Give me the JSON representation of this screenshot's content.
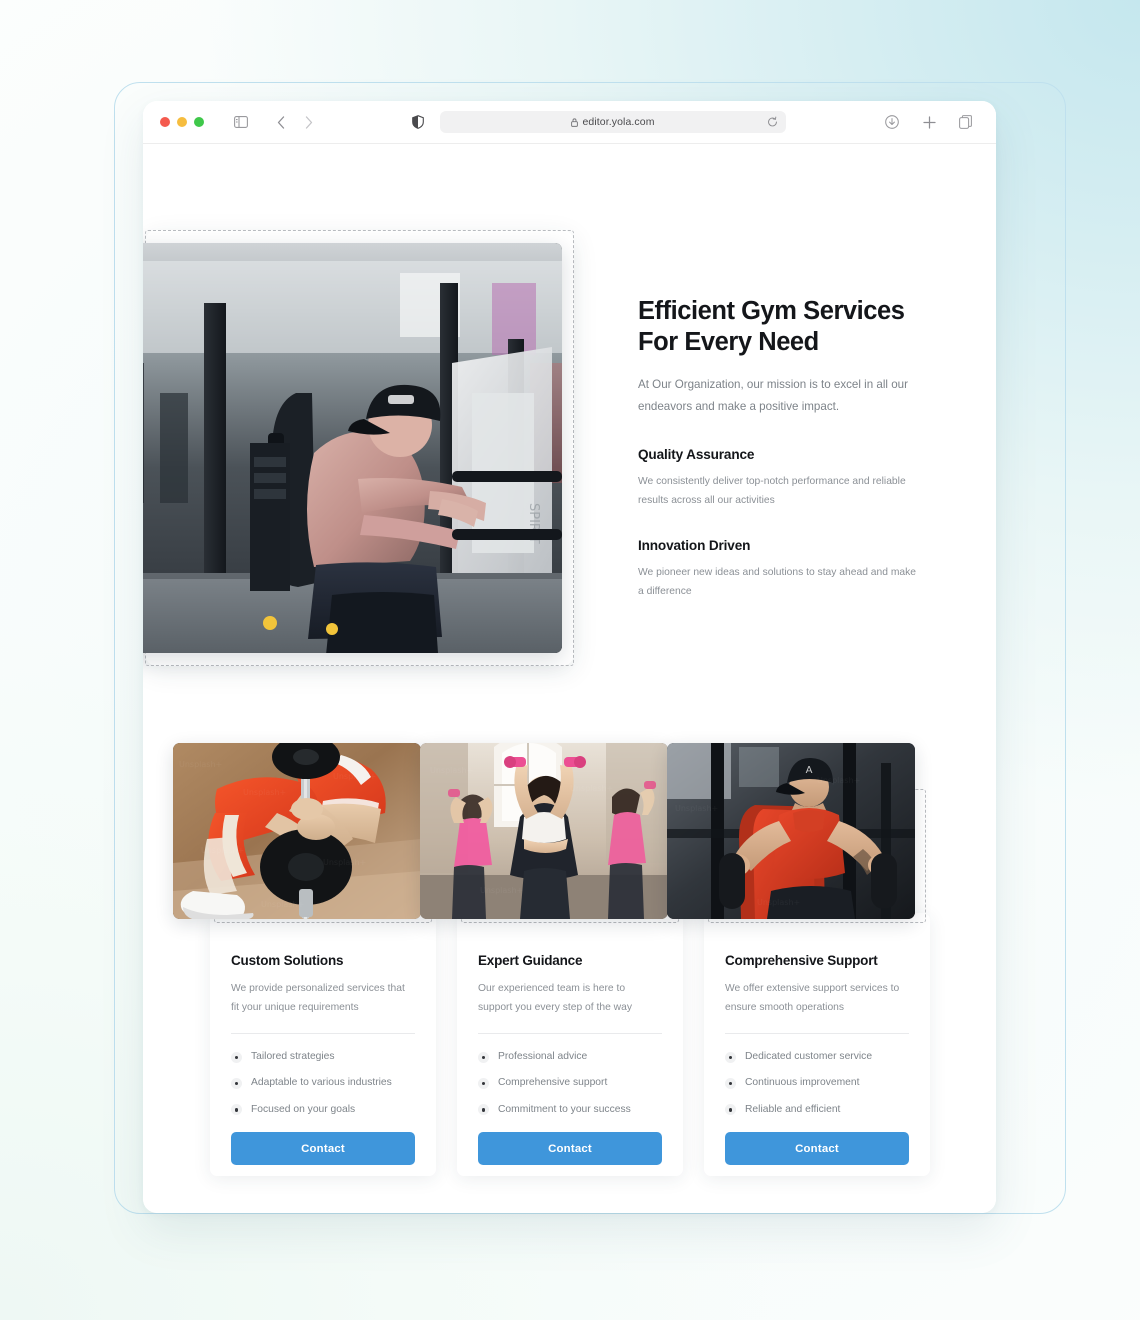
{
  "browser": {
    "traffic_lights": [
      "close",
      "minimize",
      "maximize"
    ],
    "url": "editor.yola.com",
    "lock_icon": "lock-icon",
    "sidebar_icon": "sidebar-toggle-icon",
    "back_icon": "chevron-left-icon",
    "forward_icon": "chevron-right-icon",
    "shield_icon": "shield-icon",
    "reload_icon": "reload-icon",
    "download_icon": "download-icon",
    "new_tab_icon": "plus-icon",
    "tab_overview_icon": "tab-overview-icon"
  },
  "hero": {
    "image_alt": "man-training-on-gym-cable-machine",
    "title": "Efficient Gym Services For Every Need",
    "subtitle": "At Our Organization, our mission is to excel in all our endeavors and make a positive impact.",
    "features": [
      {
        "title": "Quality Assurance",
        "body": "We consistently deliver top-notch performance and reliable results across all our activities"
      },
      {
        "title": "Innovation Driven",
        "body": "We pioneer new ideas and solutions to stay ahead and make a difference"
      }
    ]
  },
  "cards": [
    {
      "image_alt": "woman-in-red-leggings-lifting-barbell",
      "title": "Custom Solutions",
      "description": "We provide personalized services that fit your unique requirements",
      "bullets": [
        "Tailored strategies",
        "Adaptable to various industries",
        "Focused on your goals"
      ],
      "button_label": "Contact"
    },
    {
      "image_alt": "women-in-group-dumbbell-fitness-class",
      "title": "Expert Guidance",
      "description": "Our experienced team is here to support you every step of the way",
      "bullets": [
        "Professional advice",
        "Comprehensive support",
        "Commitment to your success"
      ],
      "button_label": "Contact"
    },
    {
      "image_alt": "man-in-red-tank-top-on-chest-press-machine",
      "title": "Comprehensive Support",
      "description": "We offer extensive support services to ensure smooth operations",
      "bullets": [
        "Dedicated customer service",
        "Continuous improvement",
        "Reliable and efficient"
      ],
      "button_label": "Contact"
    }
  ],
  "colors": {
    "accent_button": "#3f96db",
    "heading": "#14161a",
    "body_text": "#8b9096",
    "selection_dashed": "#b9bcc0",
    "frame_outline": "#bfe0ee"
  }
}
